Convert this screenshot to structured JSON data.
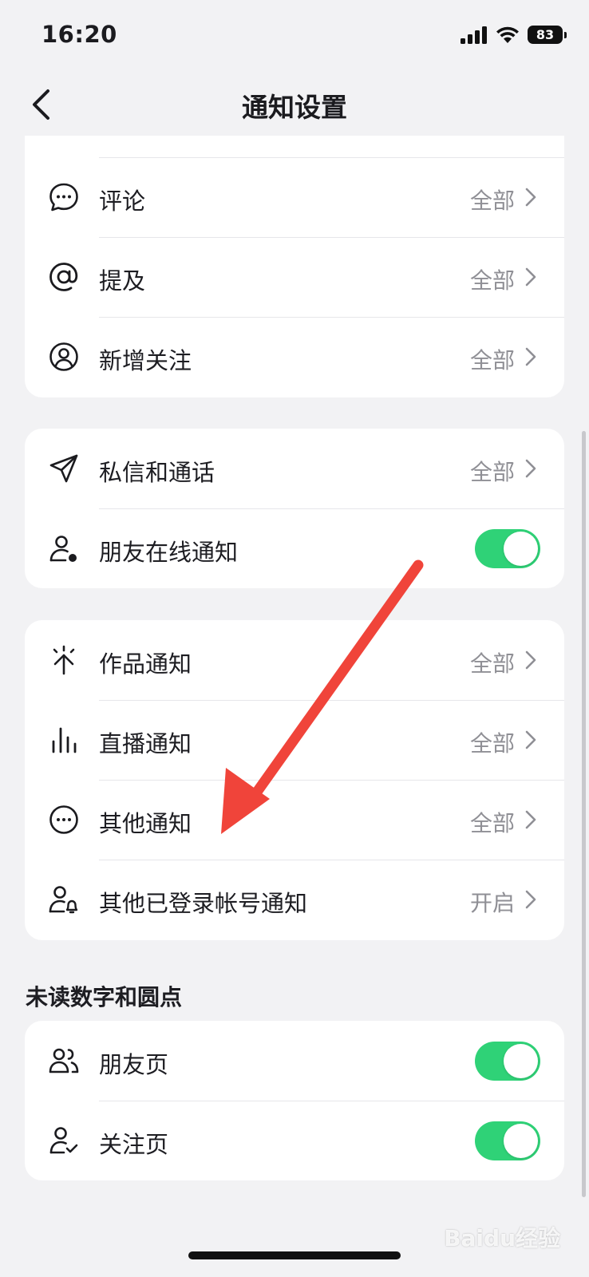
{
  "status_bar": {
    "time": "16:20",
    "battery": "83"
  },
  "header": {
    "title": "通知设置"
  },
  "group1": {
    "items": [
      {
        "label": "评论",
        "value": "全部",
        "icon": "comment-bubble-icon"
      },
      {
        "label": "提及",
        "value": "全部",
        "icon": "at-sign-icon"
      },
      {
        "label": "新增关注",
        "value": "全部",
        "icon": "user-circle-icon"
      }
    ]
  },
  "group2": {
    "items": [
      {
        "label": "私信和通话",
        "value": "全部",
        "icon": "paper-plane-icon"
      },
      {
        "label": "朋友在线通知",
        "toggle": true,
        "icon": "user-online-icon"
      }
    ]
  },
  "group3": {
    "items": [
      {
        "label": "作品通知",
        "value": "全部",
        "icon": "sparkle-arrow-icon"
      },
      {
        "label": "直播通知",
        "value": "全部",
        "icon": "bars-icon"
      },
      {
        "label": "其他通知",
        "value": "全部",
        "icon": "more-circle-icon"
      },
      {
        "label": "其他已登录帐号通知",
        "value": "开启",
        "icon": "user-bell-icon"
      }
    ]
  },
  "unread_section": {
    "title": "未读数字和圆点",
    "items": [
      {
        "label": "朋友页",
        "toggle": true,
        "icon": "friends-icon"
      },
      {
        "label": "关注页",
        "toggle": true,
        "icon": "user-check-icon"
      }
    ]
  },
  "colors": {
    "toggle_on": "#2fd277",
    "annotation_arrow": "#f0443a"
  },
  "watermark": "Baidu经验"
}
